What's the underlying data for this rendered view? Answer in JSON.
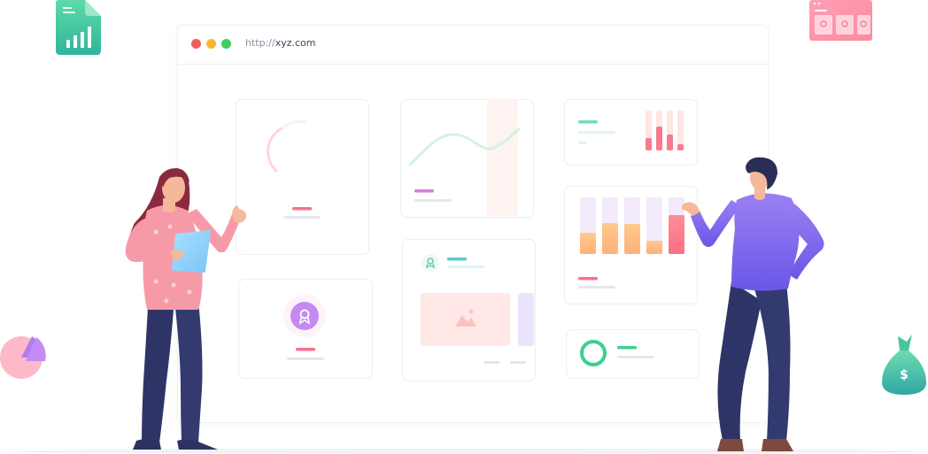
{
  "browser": {
    "url_scheme": "http://",
    "url_host": "xyz.com"
  },
  "colors": {
    "red": "#f25c5c",
    "yellow": "#f7b731",
    "green": "#3ecf5a",
    "pink": "#f4628a",
    "teal": "#3fc4ba",
    "purple": "#8b6cf0",
    "navy": "#2e3566"
  },
  "icons": {
    "money_bag": "$"
  }
}
